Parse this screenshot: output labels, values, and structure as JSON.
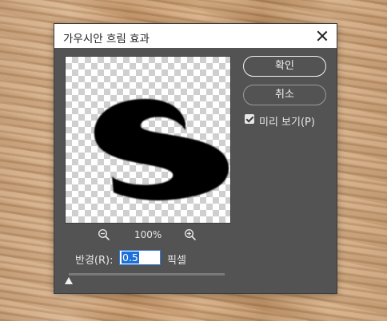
{
  "dialog": {
    "title": "가우시안 흐림 효과"
  },
  "buttons": {
    "ok_label": "확인",
    "cancel_label": "취소"
  },
  "preview_option": {
    "label": "미리 보기(P)",
    "checked": true
  },
  "zoom": {
    "level": "100%"
  },
  "radius": {
    "label": "반경(R):",
    "value": "0.5",
    "unit": "픽셀",
    "slider_fraction": 0.0
  },
  "preview_image": {
    "letter": "S"
  },
  "colors": {
    "dialog_bg": "#535353",
    "titlebar_bg": "#ffffff",
    "text": "#e6e6e6",
    "selection": "#1e6fd9"
  },
  "icons": [
    "close-icon",
    "zoom-out-icon",
    "zoom-in-icon",
    "checkbox-checked-icon"
  ]
}
